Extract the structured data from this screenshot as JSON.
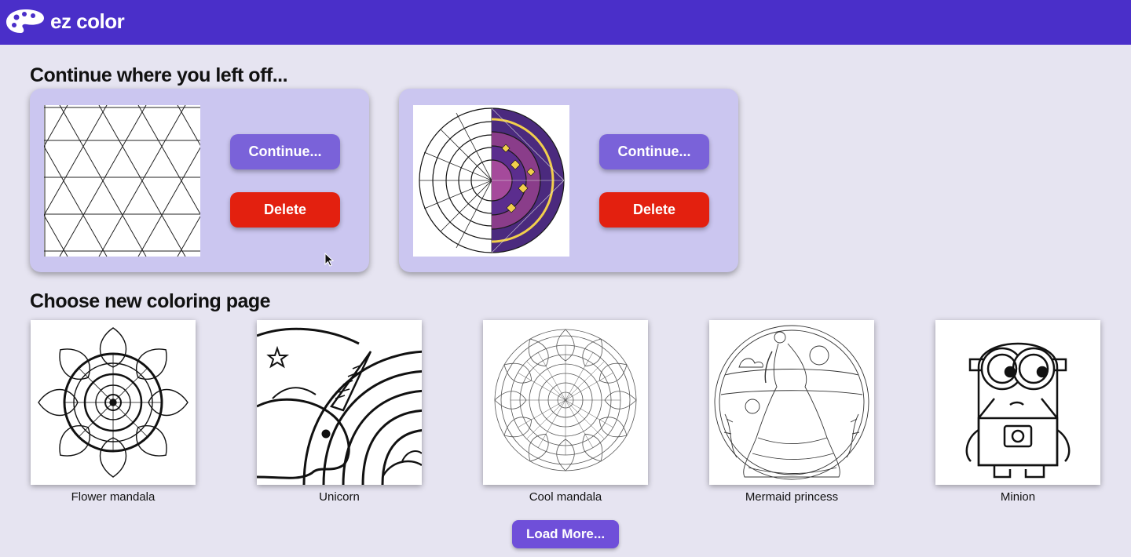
{
  "header": {
    "app_title": "ez color",
    "logo_icon": "palette-icon",
    "bg_color": "#4a2fc9"
  },
  "continue_section": {
    "title": "Continue where you left off...",
    "items": [
      {
        "thumb_icon": "triangle-grid-thumbnail",
        "continue_label": "Continue...",
        "delete_label": "Delete"
      },
      {
        "thumb_icon": "mandala-half-colored-thumbnail",
        "continue_label": "Continue...",
        "delete_label": "Delete"
      }
    ]
  },
  "choose_section": {
    "title": "Choose new coloring page",
    "pages": [
      {
        "label": "Flower mandala",
        "icon": "flower-mandala-image"
      },
      {
        "label": "Unicorn",
        "icon": "unicorn-image"
      },
      {
        "label": "Cool mandala",
        "icon": "cool-mandala-image"
      },
      {
        "label": "Mermaid princess",
        "icon": "mermaid-princess-image"
      },
      {
        "label": "Minion",
        "icon": "minion-image"
      }
    ],
    "load_more_label": "Load More..."
  },
  "colors": {
    "card_bg": "#cbc6f0",
    "continue_button": "#7a62d9",
    "delete_button": "#e3200f",
    "load_more_button": "#6f4fd9"
  }
}
